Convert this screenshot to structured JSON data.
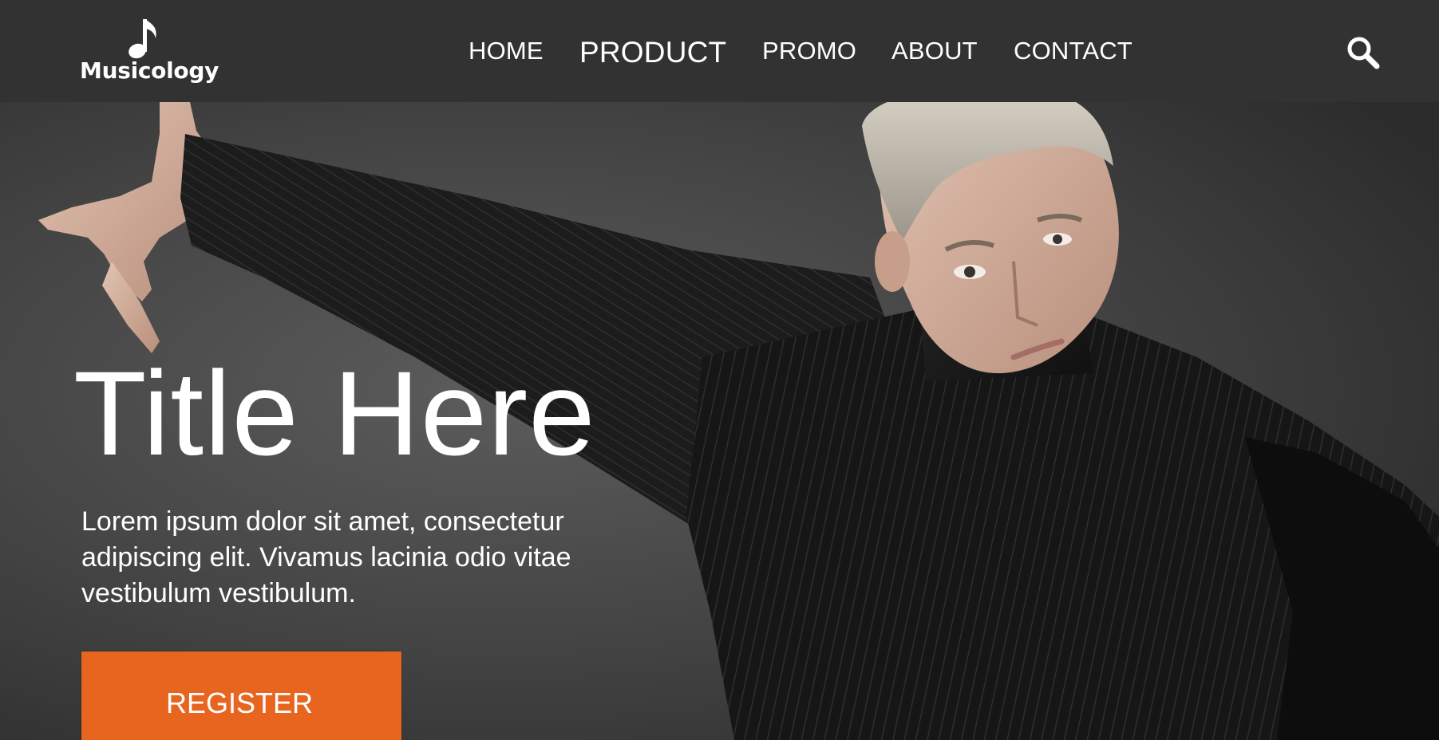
{
  "header": {
    "logo_text": "Musicology",
    "logo_icon": "music-note-icon",
    "nav": {
      "home": "HOME",
      "product": "PRODUCT",
      "promo": "PROMO",
      "about": "ABOUT",
      "contact": "CONTACT"
    },
    "active_nav": "PRODUCT",
    "search_icon": "search-icon"
  },
  "hero": {
    "title": "Title Here",
    "description": "Lorem ipsum dolor sit amet, consectetur adipiscing elit. Vivamus lacinia odio vitae vestibulum vestibulum.",
    "register_label": "REGISTER"
  },
  "colors": {
    "header_bg": "#323232",
    "accent": "#e8651f",
    "text": "#ffffff",
    "hero_bg": "#3a3a3a"
  }
}
